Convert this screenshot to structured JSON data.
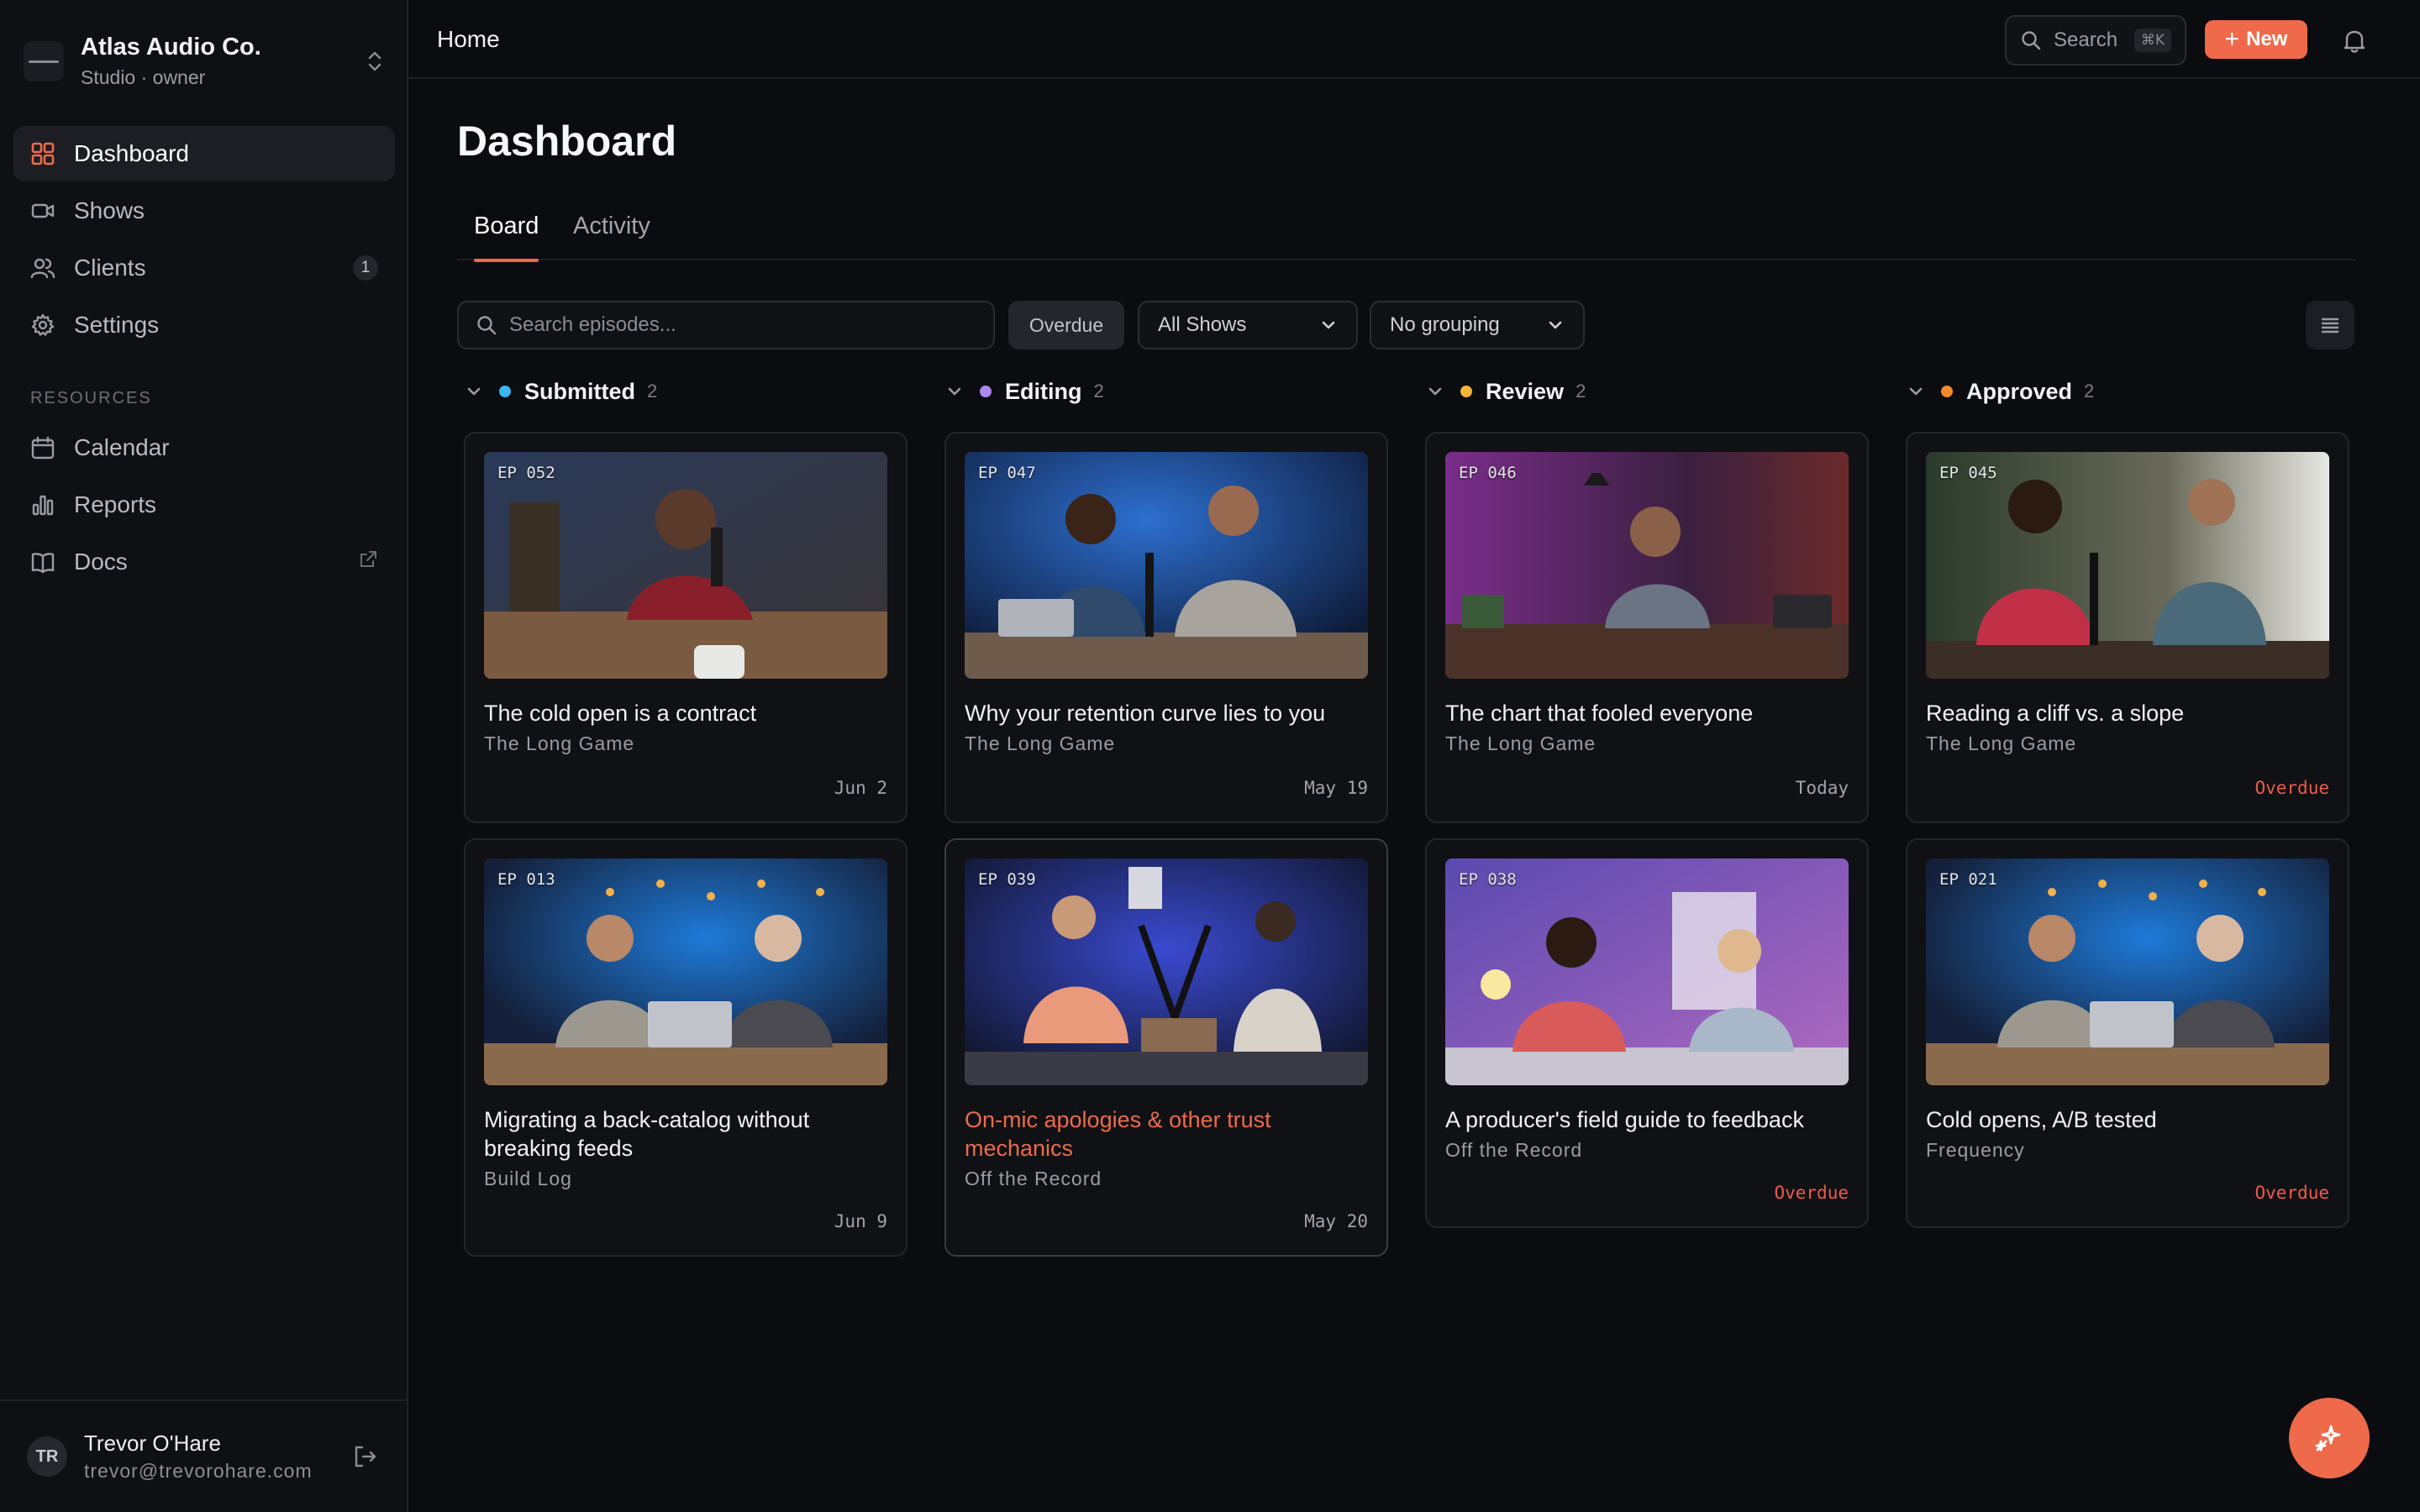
{
  "org": {
    "name": "Atlas Audio Co.",
    "role": "Studio · owner"
  },
  "nav": {
    "items": [
      {
        "label": "Dashboard"
      },
      {
        "label": "Shows"
      },
      {
        "label": "Clients",
        "badge": "1"
      },
      {
        "label": "Settings"
      }
    ],
    "resources_label": "RESOURCES",
    "resources": [
      {
        "label": "Calendar"
      },
      {
        "label": "Reports"
      },
      {
        "label": "Docs"
      }
    ]
  },
  "user": {
    "initials": "TR",
    "name": "Trevor O'Hare",
    "email": "trevor@trevorohare.com"
  },
  "topbar": {
    "breadcrumb": "Home",
    "search_label": "Search",
    "search_shortcut": "⌘K",
    "new_label": "New"
  },
  "page": {
    "title": "Dashboard",
    "tabs": [
      "Board",
      "Activity"
    ]
  },
  "filters": {
    "search_placeholder": "Search episodes...",
    "overdue_chip": "Overdue",
    "show_select": "All Shows",
    "group_select": "No grouping"
  },
  "colors": {
    "accent": "#ee6a4a",
    "submitted": "#3bb6f0",
    "editing": "#a98af0",
    "review": "#f2b43a",
    "approved": "#f08a2c",
    "overdue": "#ef5a4a"
  },
  "columns": [
    {
      "name": "Submitted",
      "count": "2",
      "cards": [
        {
          "ep": "EP 052",
          "title": "The cold open is a contract",
          "show": "The Long Game",
          "date": "Jun 2"
        },
        {
          "ep": "EP 013",
          "title": "Migrating a back-catalog without breaking feeds",
          "show": "Build Log",
          "date": "Jun 9"
        }
      ]
    },
    {
      "name": "Editing",
      "count": "2",
      "cards": [
        {
          "ep": "EP 047",
          "title": "Why your retention curve lies to you",
          "show": "The Long Game",
          "date": "May 19"
        },
        {
          "ep": "EP 039",
          "title": "On-mic apologies & other trust mechanics",
          "show": "Off the Record",
          "date": "May 20"
        }
      ]
    },
    {
      "name": "Review",
      "count": "2",
      "cards": [
        {
          "ep": "EP 046",
          "title": "The chart that fooled everyone",
          "show": "The Long Game",
          "date": "Today"
        },
        {
          "ep": "EP 038",
          "title": "A producer's field guide to feedback",
          "show": "Off the Record",
          "date": "Overdue"
        }
      ]
    },
    {
      "name": "Approved",
      "count": "2",
      "cards": [
        {
          "ep": "EP 045",
          "title": "Reading a cliff vs. a slope",
          "show": "The Long Game",
          "date": "Overdue"
        },
        {
          "ep": "EP 021",
          "title": "Cold opens, A/B tested",
          "show": "Frequency",
          "date": "Overdue"
        }
      ]
    }
  ]
}
